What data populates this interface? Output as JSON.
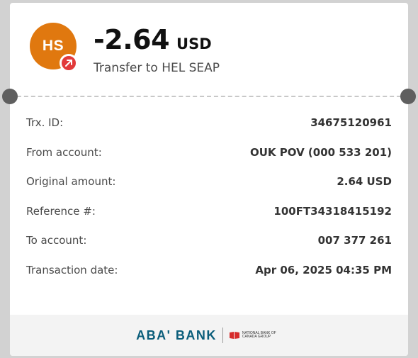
{
  "header": {
    "avatar_initials": "HS",
    "amount": "-2.64",
    "currency": "USD",
    "subtitle": "Transfer to HEL SEAP"
  },
  "details": [
    {
      "label": "Trx. ID:",
      "value": "34675120961"
    },
    {
      "label": "From account:",
      "value": "OUK POV (000 533 201)"
    },
    {
      "label": "Original amount:",
      "value": "2.64 USD"
    },
    {
      "label": "Reference #:",
      "value": "100FT34318415192"
    },
    {
      "label": "To account:",
      "value": "007 377 261"
    },
    {
      "label": "Transaction date:",
      "value": "Apr 06, 2025 04:35 PM"
    }
  ],
  "footer": {
    "logo_text": "ABA' BANK",
    "partner_text": "NATIONAL BANK OF CANADA GROUP"
  },
  "colors": {
    "avatar": "#e0780f",
    "badge": "#e23a3a",
    "brand": "#0a5d7a",
    "partner_red": "#d62b2b"
  },
  "icons": {
    "badge": "outgoing-arrow-icon",
    "partner": "national-bank-flag-icon"
  }
}
